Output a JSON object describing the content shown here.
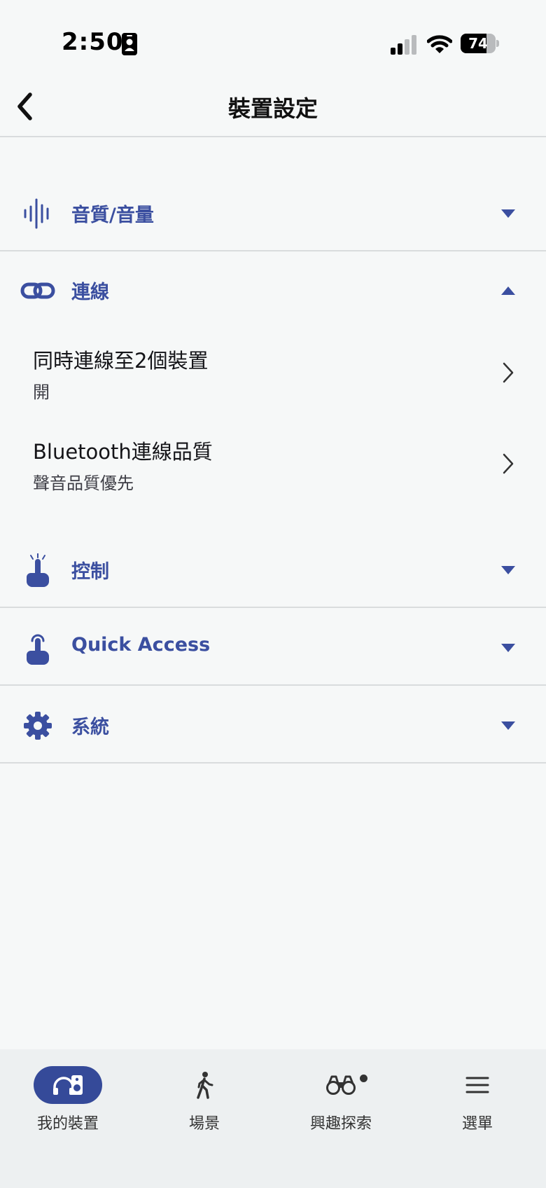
{
  "status_bar": {
    "time": "2:50",
    "battery_level": 74,
    "battery_text": "74",
    "signal_bars_active": 2,
    "signal_bars_total": 4
  },
  "nav": {
    "title": "裝置設定",
    "back_icon": "chevron-left-icon"
  },
  "colors": {
    "accent": "#3b4fa0",
    "active_tab_bg": "#354a99",
    "background": "#f6f8f8",
    "tab_bar_bg": "#edf0f1",
    "divider": "#d9dcdd"
  },
  "sections": [
    {
      "label": "音質/音量",
      "icon": "sound-wave-icon",
      "expanded": false
    },
    {
      "label": "連線",
      "icon": "link-icon",
      "expanded": true,
      "items": [
        {
          "title": "同時連線至2個裝置",
          "value": "開"
        },
        {
          "title": "Bluetooth連線品質",
          "value": "聲音品質優先"
        }
      ]
    },
    {
      "label": "控制",
      "icon": "tap-gesture-icon",
      "expanded": false
    },
    {
      "label": "Quick Access",
      "icon": "touch-hold-icon",
      "expanded": false
    },
    {
      "label": "系統",
      "icon": "gear-icon",
      "expanded": false
    }
  ],
  "tabs": [
    {
      "label": "我的裝置",
      "icon": "headphones-speaker-icon",
      "active": true
    },
    {
      "label": "場景",
      "icon": "walking-person-icon",
      "active": false
    },
    {
      "label": "興趣探索",
      "icon": "binoculars-icon",
      "active": false,
      "badge": true
    },
    {
      "label": "選單",
      "icon": "menu-icon",
      "active": false
    }
  ]
}
